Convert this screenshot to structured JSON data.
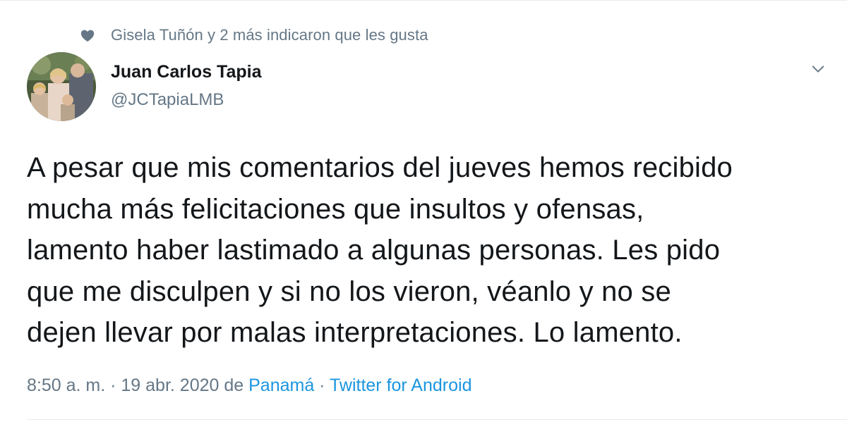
{
  "social_context": {
    "icon": "heart-icon",
    "text": "Gisela Tuñón y 2 más indicaron que les gusta"
  },
  "author": {
    "name": "Juan Carlos Tapia",
    "handle": "@JCTapiaLMB",
    "avatar": "avatar-photo"
  },
  "menu": {
    "icon": "chevron-down-icon"
  },
  "tweet": {
    "text": "A pesar que mis comentarios del jueves hemos recibido\nmucha más felicitaciones que insultos y ofensas,\nlamento haber lastimado a algunas personas. Les pido\nque me disculpen y si no los vieron, véanlo y no se\ndejen llevar por malas interpretaciones. Lo lamento."
  },
  "meta": {
    "time": "8:50 a. m.",
    "sep1": " · ",
    "date": "19 abr. 2020",
    "from": " de ",
    "location": "Panamá",
    "sep2": " · ",
    "source": "Twitter for Android"
  },
  "colors": {
    "text": "#14171a",
    "secondary": "#657786",
    "link": "#1b95e0"
  }
}
